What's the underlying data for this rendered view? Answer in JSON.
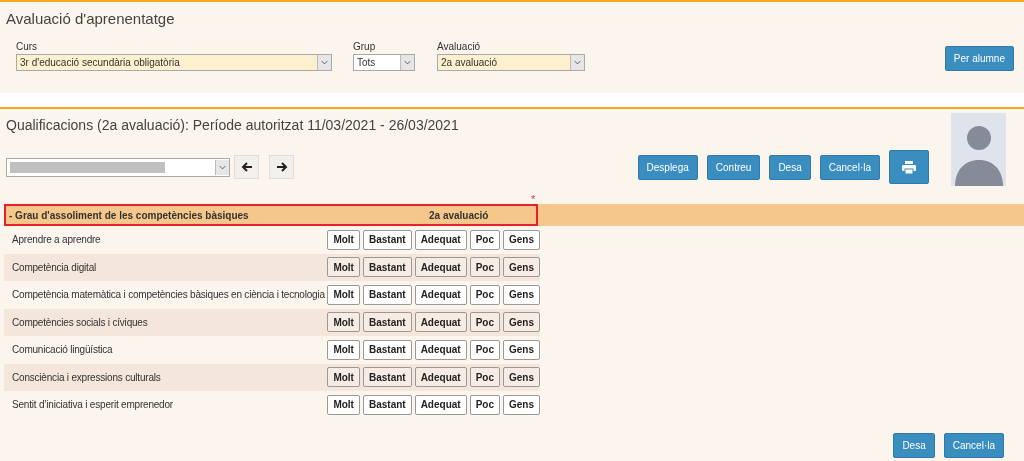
{
  "page_title": "Avaluació d'aprenentatge",
  "filters": [
    {
      "label": "Curs",
      "value": "3r d'educació secundària obligatòria",
      "highlighted": true
    },
    {
      "label": "Grup",
      "value": "Tots",
      "highlighted": false
    },
    {
      "label": "Avaluació",
      "value": "2a avaluació",
      "highlighted": true
    }
  ],
  "per_student_button": "Per alumne",
  "section_title": "Qualificacions (2a avaluació): Període autoritzat 11/03/2021 - 26/03/2021",
  "actions": [
    "Desplega",
    "Contreu",
    "Desa",
    "Cancel·la"
  ],
  "required_mark": "*",
  "table_header": {
    "title": "- Grau d'assoliment de les competències bàsiques",
    "column": "2a avaluació"
  },
  "rows": [
    {
      "label": "Aprendre a aprendre",
      "options": [
        "Molt",
        "Bastant",
        "Adequat",
        "Poc",
        "Gens"
      ]
    },
    {
      "label": "Competència digital",
      "options": [
        "Molt",
        "Bastant",
        "Adequat",
        "Poc",
        "Gens"
      ]
    },
    {
      "label": "Competència matemàtica i competències bàsiques en ciència i tecnologia",
      "options": [
        "Molt",
        "Bastant",
        "Adequat",
        "Poc",
        "Gens"
      ]
    },
    {
      "label": "Competències socials i cíviques",
      "options": [
        "Molt",
        "Bastant",
        "Adequat",
        "Poc",
        "Gens"
      ]
    },
    {
      "label": "Comunicació lingüística",
      "options": [
        "Molt",
        "Bastant",
        "Adequat",
        "Poc",
        "Gens"
      ]
    },
    {
      "label": "Consciència i expressions culturals",
      "options": [
        "Molt",
        "Bastant",
        "Adequat",
        "Poc",
        "Gens"
      ]
    },
    {
      "label": "Sentit d’iniciativa i esperit emprenedor",
      "options": [
        "Molt",
        "Bastant",
        "Adequat",
        "Poc",
        "Gens"
      ]
    }
  ],
  "footer_buttons": [
    "Desa",
    "Cancel·la"
  ]
}
